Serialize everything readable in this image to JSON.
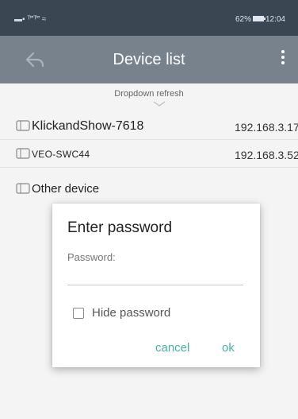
{
  "status_bar": {
    "left_text": "▬▪ ᵀ‴ᵀ‴ ≈",
    "battery_percent": "62%",
    "time": "12:04"
  },
  "app_bar": {
    "title": "Device list"
  },
  "list": {
    "refresh_hint": "Dropdown refresh",
    "devices": [
      {
        "name": "KlickandShow-7618",
        "ip": "192.168.3.17"
      },
      {
        "name": "VEO-SWC44",
        "ip": "192.168.3.52"
      }
    ],
    "other_label": "Other device"
  },
  "dialog": {
    "title": "Enter password",
    "password_label": "Password:",
    "password_value": "",
    "hide_password_label": "Hide password",
    "hide_password_checked": false,
    "cancel_label": "cancel",
    "ok_label": "ok"
  },
  "colors": {
    "status_bar": "#3a4652",
    "app_bar": "#78828c",
    "accent": "#45b3a4"
  }
}
